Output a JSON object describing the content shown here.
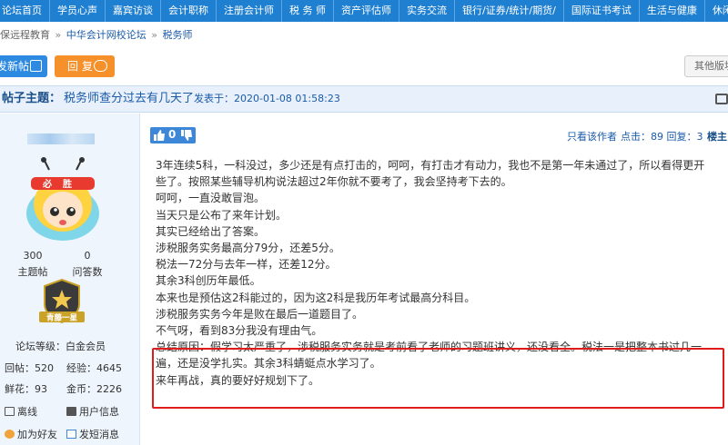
{
  "nav": [
    "论坛首页",
    "学员心声",
    "嘉宾访谈",
    "会计职称",
    "注册会计师",
    "税 务 师",
    "资产评估师",
    "实务交流",
    "银行/证券/统计/期货/",
    "国际证书考试",
    "生活与健康",
    "休闲娱乐"
  ],
  "breadcrumb": {
    "prefix": "保远程教育",
    "forum": "中华会计网校论坛",
    "section": "税务师",
    "separator": "»"
  },
  "actions": {
    "new_post": "发新帖",
    "reply": "回 复",
    "other": "其他版块"
  },
  "thread": {
    "label": "帖子主题：",
    "subject": "税务师查分过去有几天了",
    "posted": "发表于：2020-01-08 01:58:23"
  },
  "user": {
    "topics_num": "300",
    "topics_label": "主题帖",
    "answers_num": "0",
    "answers_label": "问答数",
    "badge_text": "青藤一星",
    "avatar_text": "必胜",
    "level": "论坛等级：白金会员",
    "points_label": "回帖：",
    "points": "520",
    "exp_label": "经验：",
    "exp": "4645",
    "flowers_label": "鲜花：",
    "flowers": "93",
    "gold_label": "金币：",
    "gold": "2226",
    "offline": "离线",
    "info": "用户信息",
    "add_friend": "加为好友",
    "message": "发短消息"
  },
  "post": {
    "likes": "0",
    "only_author": "只看该作者",
    "stats": "点击：89 回复：3",
    "floor": "楼主",
    "lines": [
      "3年连续5科，一科没过，多少还是有点打击的，呵呵，有打击才有动力，我也不是第一年未通过了，所以看得更开",
      "些了。按照某些辅导机构说法超过2年你就不要考了，我会坚持考下去的。",
      "呵呵，一直没敢冒泡。",
      "当天只是公布了来年计划。",
      "其实已经给出了答案。",
      "涉税服务实务最高分79分，还差5分。",
      "税法一72分与去年一样，还差12分。",
      "其余3科创历年最低。",
      "本来也是预估这2科能过的，因为这2科是我历年考试最高分科目。",
      "涉税服务实务今年是败在最后一道题目了。",
      "不气呀，看到83分我没有理由气。",
      "总结原因：假学习太严重了，涉税服务实务就是考前看了老师的习题班讲义，还没看全。税法一是把整本书过几一",
      "遍，还是没学扎实。其余3科蜻蜓点水学习了。",
      "来年再战，真的要好好规划下了。"
    ]
  },
  "colors": {
    "nav": "#1f7fd0",
    "new_btn": "#2d8ae0",
    "reply_btn": "#f6902b",
    "highlight": "#e01b1b"
  }
}
